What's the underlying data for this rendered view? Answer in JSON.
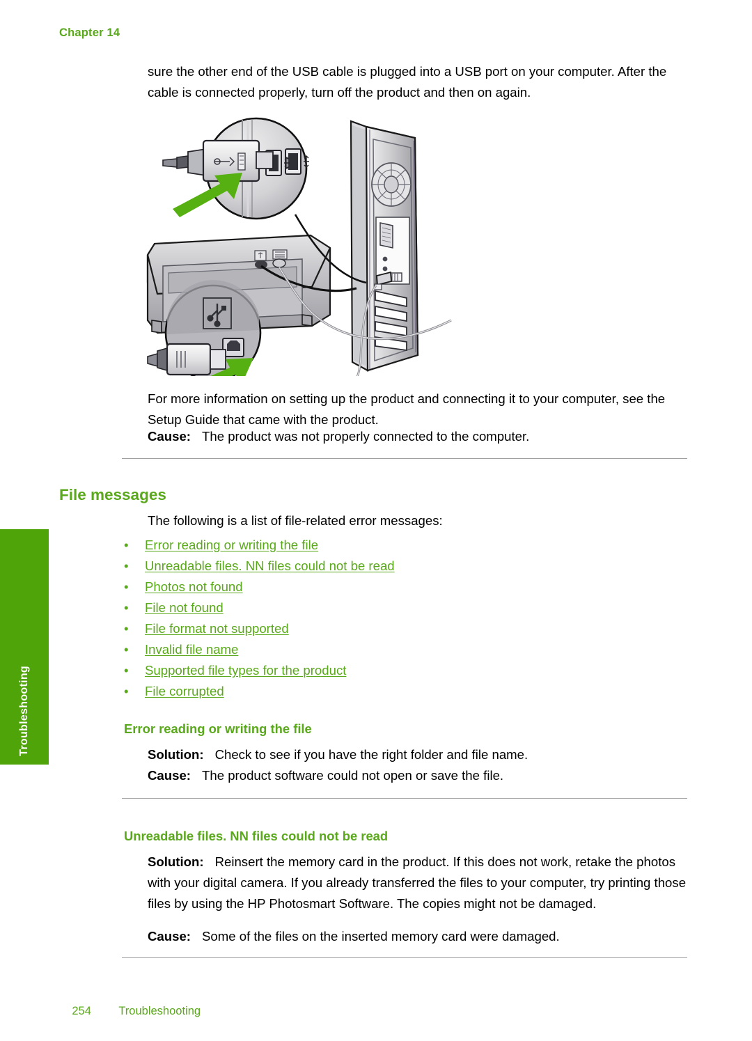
{
  "header": {
    "chapter": "Chapter 14"
  },
  "side_tab": {
    "label": "Troubleshooting",
    "color": "#4fa409"
  },
  "intro": {
    "paragraph": "sure the other end of the USB cable is plugged into a USB port on your computer. After the cable is connected properly, turn off the product and then on again."
  },
  "figure": {
    "caption": "",
    "alt": "Diagram showing a USB cable being connected to a USB port on the back of a computer tower and to the USB port on the back of the printer",
    "callouts": [
      "computer-usb-port-detail",
      "printer-usb-port-detail"
    ]
  },
  "after_figure": {
    "paragraph": "For more information on setting up the product and connecting it to your computer, see the Setup Guide that came with the product.",
    "cause_label": "Cause:",
    "cause_text": "The product was not properly connected to the computer."
  },
  "file_messages": {
    "heading": "File messages",
    "intro": "The following is a list of file-related error messages:",
    "links": [
      "Error reading or writing the file",
      "Unreadable files. NN files could not be read",
      "Photos not found",
      "File not found",
      "File format not supported",
      "Invalid file name",
      "Supported file types for the product",
      "File corrupted"
    ]
  },
  "sections": [
    {
      "heading": "Error reading or writing the file",
      "solution_label": "Solution:",
      "solution_text": "Check to see if you have the right folder and file name.",
      "cause_label": "Cause:",
      "cause_text": "The product software could not open or save the file."
    },
    {
      "heading": "Unreadable files. NN files could not be read",
      "solution_label": "Solution:",
      "solution_text": "Reinsert the memory card in the product. If this does not work, retake the photos with your digital camera. If you already transferred the files to your computer, try printing those files by using the HP Photosmart Software. The copies might not be damaged.",
      "cause_label": "Cause:",
      "cause_text": "Some of the files on the inserted memory card were damaged."
    }
  ],
  "footer": {
    "page_number": "254",
    "section": "Troubleshooting"
  },
  "colors": {
    "accent_green": "#5aa81b",
    "tab_green": "#4fa409",
    "rule_gray": "#a0a0a4"
  }
}
